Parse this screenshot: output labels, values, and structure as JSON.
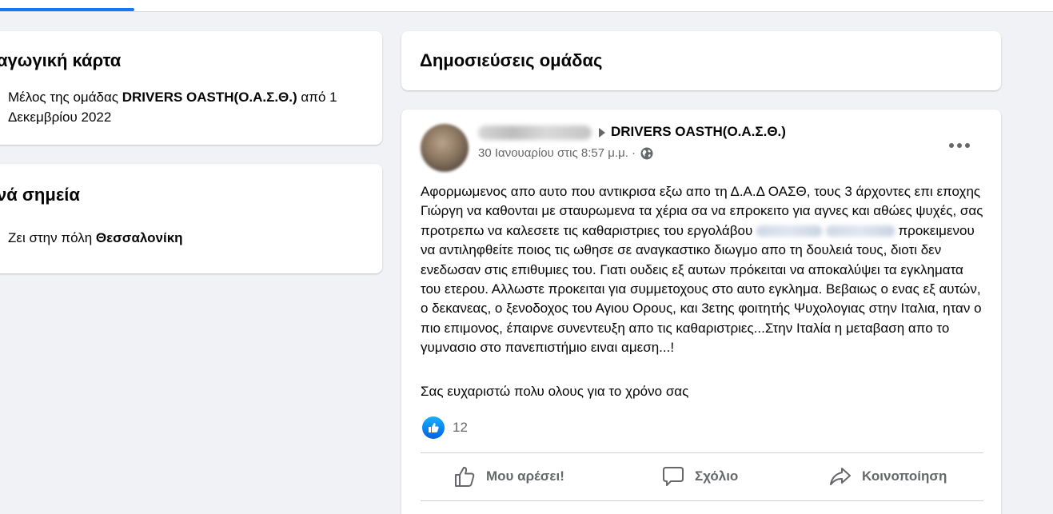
{
  "intro": {
    "title": "αγωγική κάρτα",
    "member_prefix": "Μέλος της ομάδας ",
    "member_group": "DRIVERS OASTH(Ο.Α.Σ.Θ.)",
    "member_suffix": " από 1",
    "member_date_line2": "Δεκεμβρίου 2022"
  },
  "places": {
    "title": "νά σημεία",
    "lives_prefix": "Ζει στην πόλη ",
    "lives_city": "Θεσσαλονίκη"
  },
  "posts_header": {
    "title": "Δημοσιεύσεις ομάδας"
  },
  "post": {
    "group": "DRIVERS OASTH(Ο.Α.Σ.Θ.)",
    "timestamp": "30 Ιανουαρίου στις 8:57 μ.μ. ·",
    "body_part1": "Αφορμωμενος απο αυτο που αντικρισα εξω απο τη Δ.Α.Δ ΟΑΣΘ, τους 3 άρχοντες επι εποχης Γιώργη να καθονται με σταυρωμενα τα χέρια σα να επροκειτο για αγνες και αθώες ψυχές, σας προτρεπω να καλεσετε τις καθαριστριες του εργολάβου",
    "body_part2": " προκειμενου να αντιληφθείτε ποιος τις ωθησε σε αναγκαστικο διωγμο απο τη δουλειά τους, διοτι δεν ενεδωσαν στις επιθυμιες του. Γιατι ουδεις εξ αυτων πρόκειται να αποκαλύψει τα εγκληματα του ετερου. Αλλωστε προκειται για συμμετοχους στο αυτο εγκλημα. Βεβαιως ο ενας εξ αυτών, ο δεκανεας, ο ξενοδοχος του Αγιου Ορους, και 3ετης φοιτητής Ψυχολογιας στην Ιταλια, ηταν ο πιο επιμονος, έπαιρνε συνεντευξη απο τις καθαριστριες...Στην Ιταλία η μεταβαση απο το γυμνασιο στο πανεπιστήμιο ειναι αμεση...!",
    "thanks": "Σας ευχαριστώ πολυ ολους για το χρόνο σας",
    "reaction_count": "12",
    "actions": {
      "like": "Μου αρέσει!",
      "comment": "Σχόλιο",
      "share": "Κοινοποίηση"
    }
  },
  "colors": {
    "accent": "#1877f2",
    "background": "#f0f2f5",
    "secondary_text": "#65676b"
  }
}
